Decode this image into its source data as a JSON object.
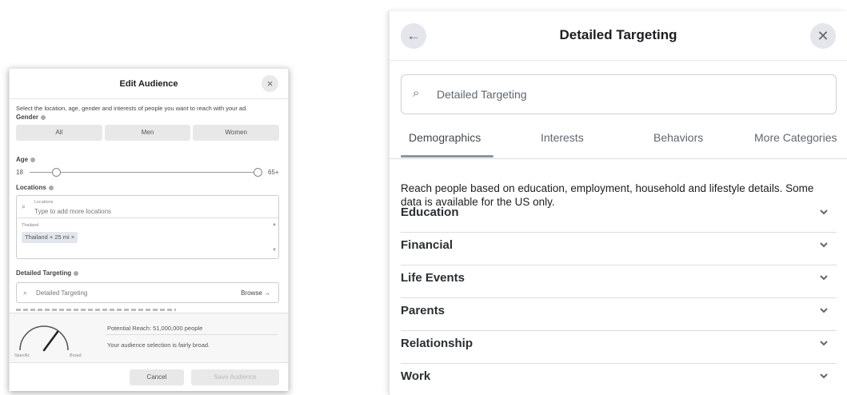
{
  "edit_audience": {
    "title": "Edit Audience",
    "close_icon": "×",
    "description": "Select the location, age, gender and interests of people you want to reach with your ad.",
    "gender": {
      "label": "Gender",
      "options": [
        "All",
        "Men",
        "Women"
      ]
    },
    "age": {
      "label": "Age",
      "min": "18",
      "max": "65+"
    },
    "locations": {
      "label": "Locations",
      "field_small_label": "Locations",
      "placeholder": "Type to add more locations",
      "country": "Thailand",
      "tag": "Thailand",
      "tag_radius": "+ 25 mi",
      "tag_remove": "×"
    },
    "detailed_targeting": {
      "label": "Detailed Targeting",
      "placeholder": "Detailed Targeting",
      "browse": "Browse →"
    },
    "reach": {
      "gauge_left": "Specific",
      "gauge_right": "Broad",
      "potential_reach": "Potential Reach: 51,000,000 people",
      "note": "Your audience selection is fairly broad."
    },
    "footer": {
      "cancel": "Cancel",
      "save": "Save Audience"
    }
  },
  "detailed_targeting_panel": {
    "title": "Detailed Targeting",
    "back_icon": "arrow-left-icon",
    "close_icon": "close-icon",
    "search": {
      "placeholder": "Detailed Targeting"
    },
    "tabs": [
      {
        "label": "Demographics",
        "active": true
      },
      {
        "label": "Interests",
        "active": false
      },
      {
        "label": "Behaviors",
        "active": false
      },
      {
        "label": "More Categories",
        "active": false
      }
    ],
    "description": "Reach people based on education, employment, household and lifestyle details. Some data is available for the US only.",
    "categories": [
      "Education",
      "Financial",
      "Life Events",
      "Parents",
      "Relationship",
      "Work"
    ]
  }
}
